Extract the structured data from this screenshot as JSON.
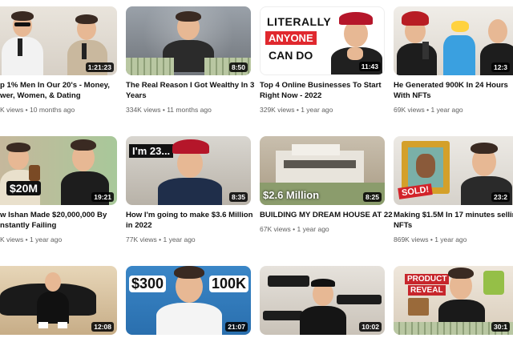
{
  "videos": [
    {
      "title_line1": "p 1% Men In Our 20's - Money,",
      "title_line2": "wer, Women, & Dating",
      "views": "K views",
      "age": "10 months ago",
      "duration": "1:21:23"
    },
    {
      "title_line1": "The Real Reason I Got Wealthy In 3",
      "title_line2": "Years",
      "views": "334K views",
      "age": "11 months ago",
      "duration": "8:50"
    },
    {
      "title_line1": "Top 4 Online Businesses To Start",
      "title_line2": "Right Now - 2022",
      "views": "329K views",
      "age": "1 year ago",
      "duration": "11:43",
      "thumb_text": [
        "LITERALLY",
        "ANYONE",
        "CAN DO"
      ]
    },
    {
      "title_line1": "He Generated 900K In 24 Hours",
      "title_line2": "With NFTs",
      "views": "69K views",
      "age": "1 year ago",
      "duration": "12:3"
    },
    {
      "title_line1": "w Ishan Made $20,000,000 By",
      "title_line2": "nstantly Failing",
      "views": "K views",
      "age": "1 year ago",
      "duration": "19:21",
      "thumb_text": "$20M"
    },
    {
      "title_line1": "How I'm going to make $3.6 Million",
      "title_line2": "in 2022",
      "views": "77K views",
      "age": "1 year ago",
      "duration": "8:35",
      "thumb_text": "I'm 23..."
    },
    {
      "title_line1": "BUILDING MY DREAM HOUSE AT 22",
      "title_line2": "",
      "views": "67K views",
      "age": "1 year ago",
      "duration": "8:25",
      "thumb_text": "$2.6 Million"
    },
    {
      "title_line1": "Making $1.5M In 17 minutes selling",
      "title_line2": "NFTs",
      "views": "869K views",
      "age": "1 year ago",
      "duration": "23:2",
      "thumb_text": "SOLD!"
    },
    {
      "duration": "12:08"
    },
    {
      "duration": "21:07",
      "thumb_text": [
        "$300",
        "100K"
      ]
    },
    {
      "duration": "10:02"
    },
    {
      "duration": "30:1",
      "thumb_text": [
        "PRODUCT",
        "REVEAL"
      ]
    }
  ],
  "separator": "•"
}
